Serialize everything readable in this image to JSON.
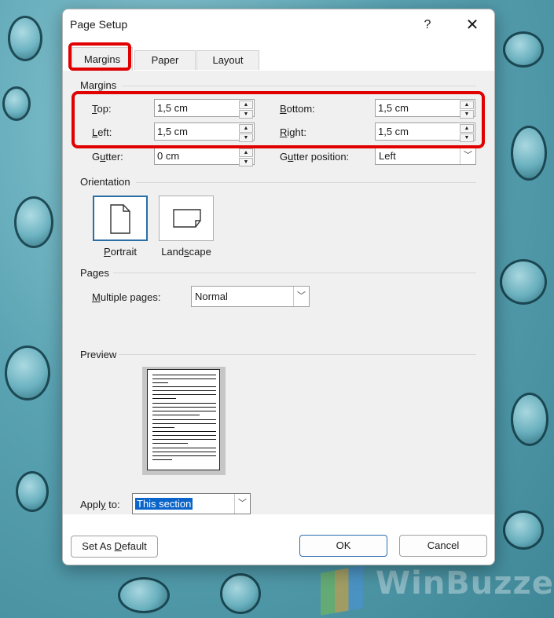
{
  "dialog": {
    "title": "Page Setup",
    "help_glyph": "?",
    "close_glyph": "✕"
  },
  "tabs": [
    {
      "label": "Margins",
      "active": true
    },
    {
      "label": "Paper",
      "active": false
    },
    {
      "label": "Layout",
      "active": false
    }
  ],
  "margins": {
    "section_label": "Margins",
    "top": {
      "label_u": "T",
      "label_rest": "op:",
      "value": "1,5 cm"
    },
    "left": {
      "label_u": "L",
      "label_rest": "eft:",
      "value": "1,5 cm"
    },
    "gutter": {
      "label_pre": "G",
      "label_u": "u",
      "label_rest": "tter:",
      "value": "0 cm"
    },
    "bottom": {
      "label_u": "B",
      "label_rest": "ottom:",
      "value": "1,5 cm"
    },
    "right": {
      "label_u": "R",
      "label_rest": "ight:",
      "value": "1,5 cm"
    },
    "gutter_position": {
      "label_pre": "G",
      "label_u": "u",
      "label_rest": "tter position:",
      "value": "Left"
    }
  },
  "orientation": {
    "section_label": "Orientation",
    "portrait": {
      "label_u": "P",
      "label_rest": "ortrait",
      "selected": true
    },
    "landscape": {
      "label_pre": "Land",
      "label_u": "s",
      "label_rest": "cape",
      "selected": false
    }
  },
  "pages": {
    "section_label": "Pages",
    "multiple_pages": {
      "label_u": "M",
      "label_rest": "ultiple pages:",
      "value": "Normal"
    }
  },
  "preview": {
    "section_label": "Preview"
  },
  "apply_to": {
    "label_pre": "Appl",
    "label_u": "y",
    "label_rest": " to:",
    "value": "This section"
  },
  "footer": {
    "set_default": {
      "label_pre": "Set As ",
      "label_u": "D",
      "label_rest": "efault"
    },
    "ok_label": "OK",
    "cancel_label": "Cancel"
  },
  "colors": {
    "highlight": "#e00000",
    "selection": "#0a64c9",
    "accent": "#2a6ea6"
  },
  "watermark": "WinBuzzer"
}
